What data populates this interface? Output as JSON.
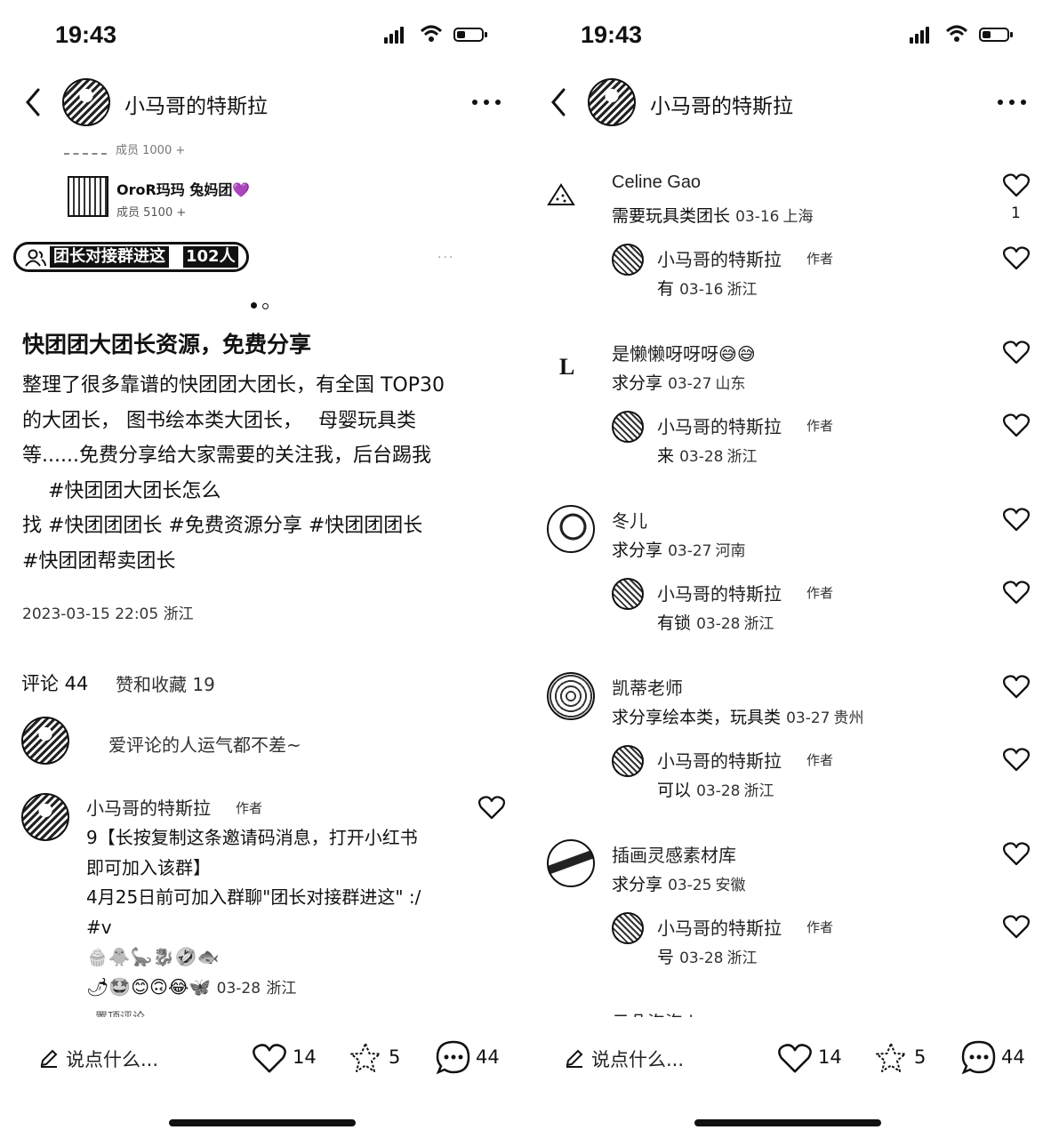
{
  "status": {
    "time": "19:43"
  },
  "header": {
    "title": "小马哥的特斯拉",
    "back_icon": "chevron-left-icon",
    "more_icon": "more-dots-icon"
  },
  "left": {
    "partial_top_text": "成员 1000 +",
    "group_owner": {
      "name": "OroR玛玛 兔妈团💜",
      "members": "成员 5100 +"
    },
    "group_chip": {
      "label": "团长对接群进这",
      "count": "102人"
    },
    "post_title": "快团团大团长资源，免费分享",
    "post_body": [
      "整理了很多靠谱的快团团大团长，有全国 TOP30",
      "的大团长， 图书绘本类大团长，　 母婴玩具类",
      "等......免费分享给大家需要的关注我，后台踢我",
      "　 #快团团大团长怎么",
      "找  #快团团团长  #免费资源分享  #快团团团长",
      "#快团团帮卖团长"
    ],
    "post_date": "2023-03-15 22:05 浙江",
    "tabs": {
      "comments": "评论 44",
      "likes": "赞和收藏 19"
    },
    "comment_prompt": "爱评论的人运气都不差~",
    "author_comment": {
      "name": "小马哥的特斯拉",
      "tag": "作者",
      "lines": [
        "9【长按复制这条邀请码消息，打开小红书",
        "即可加入该群】",
        " 4月25日前可加入群聊\"团长对接群进这\" :/",
        "#v",
        "🧁🐥🦕🐉🤣🐟",
        "🌶🤩😊🙃😂🦋"
      ],
      "date": "03-28",
      "loc": "浙江",
      "pinned": "置顶评论"
    }
  },
  "right": {
    "comments": [
      {
        "name": "Celine Gao",
        "text": "需要玩具类团长",
        "date": "03-16",
        "loc": "上海",
        "likes": "1",
        "reply": {
          "name": "小马哥的特斯拉",
          "tag": "作者",
          "text": "有",
          "date": "03-16",
          "loc": "浙江"
        }
      },
      {
        "name": "是懒懒呀呀呀😅😅",
        "text": "求分享",
        "date": "03-27",
        "loc": "山东",
        "likes": "",
        "reply": {
          "name": "小马哥的特斯拉",
          "tag": "作者",
          "text": "来",
          "date": "03-28",
          "loc": "浙江"
        }
      },
      {
        "name": "冬儿",
        "text": "求分享",
        "date": "03-27",
        "loc": "河南",
        "likes": "",
        "reply": {
          "name": "小马哥的特斯拉",
          "tag": "作者",
          "text": "有锁",
          "date": "03-28",
          "loc": "浙江"
        }
      },
      {
        "name": "凯蒂老师",
        "text": "求分享绘本类，玩具类",
        "date": "03-27",
        "loc": "贵州",
        "likes": "",
        "reply": {
          "name": "小马哥的特斯拉",
          "tag": "作者",
          "text": "可以",
          "date": "03-28",
          "loc": "浙江"
        }
      },
      {
        "name": "插画灵感素材库",
        "text": "求分享",
        "date": "03-25",
        "loc": "安徽",
        "likes": "",
        "reply": {
          "name": "小马哥的特斯拉",
          "tag": "作者",
          "text": "号",
          "date": "03-28",
          "loc": "浙江"
        }
      }
    ],
    "partial_name": "云朵泡泡 in"
  },
  "bottom": {
    "input_placeholder": "说点什么...",
    "likes": "14",
    "stars": "5",
    "comments": "44"
  }
}
